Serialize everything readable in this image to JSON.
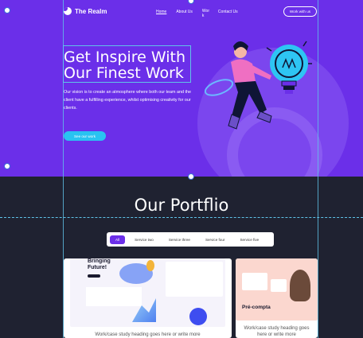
{
  "brand": {
    "name": "The Realm"
  },
  "nav": {
    "items": [
      {
        "label": "Home"
      },
      {
        "label": "About Us"
      },
      {
        "label": "Wor k"
      },
      {
        "label": "Contact Us"
      }
    ],
    "cta": "Work with us"
  },
  "hero": {
    "title_line1": "Get Inspire With",
    "title_line2": "Our Finest Work",
    "description": "Our vision is to create an atmosphere where both our team and the client have a fulfilling experience, whilst optimising creativity for our clients.",
    "button": "See our work"
  },
  "portfolio": {
    "title": "Our Portflio",
    "tabs": [
      {
        "label": "All"
      },
      {
        "label": "Service two"
      },
      {
        "label": "Service three"
      },
      {
        "label": "Service four"
      },
      {
        "label": "Service five"
      }
    ],
    "cards": [
      {
        "caption": "Work/case study heading goes here or write more",
        "mock_heading": "Bringing Future!"
      },
      {
        "caption": "Work/case study heading goes here or write more",
        "mock_heading": "Pré-compta"
      }
    ]
  },
  "colors": {
    "hero": "#6b2fe9",
    "dark": "#1f2231",
    "accent": "#29c3f1",
    "guide": "#5fc3e8"
  }
}
